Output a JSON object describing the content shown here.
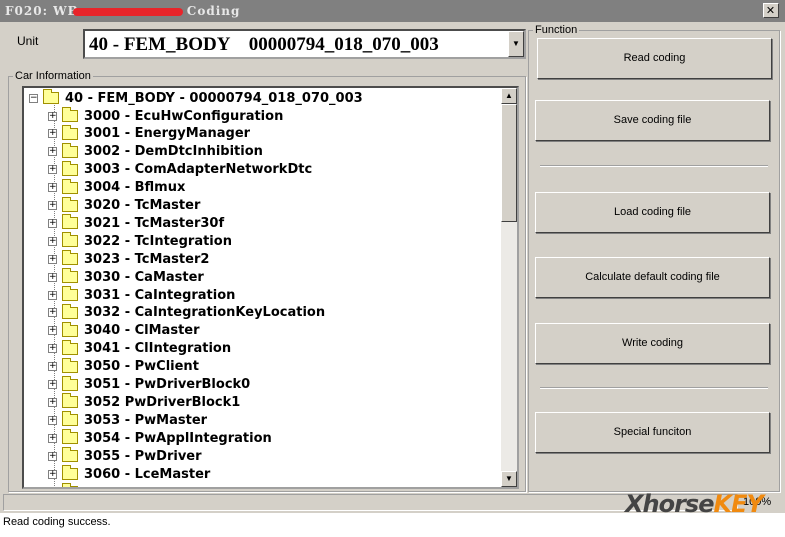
{
  "window": {
    "title_prefix": "F020: WB",
    "title_suffix": "Coding",
    "close": "✕"
  },
  "unit": {
    "label": "Unit",
    "value": "40 - FEM_BODY    00000794_018_070_003"
  },
  "car_info": {
    "legend": "Car Information",
    "root": "40 - FEM_BODY - 00000794_018_070_003",
    "items": [
      "3000 - EcuHwConfiguration",
      "3001 - EnergyManager",
      "3002 - DemDtcInhibition",
      "3003 - ComAdapterNetworkDtc",
      "3004 - Bflmux",
      "3020 - TcMaster",
      "3021 - TcMaster30f",
      "3022 - TcIntegration",
      "3023 - TcMaster2",
      "3030 - CaMaster",
      "3031 - CaIntegration",
      "3032 - CaIntegrationKeyLocation",
      "3040 - ClMaster",
      "3041 - ClIntegration",
      "3050 - PwClient",
      "3051 - PwDriverBlock0",
      "3052   PwDriverBlock1",
      "3053 - PwMaster",
      "3054 - PwApplIntegration",
      "3055 - PwDriver",
      "3060 - LceMaster"
    ]
  },
  "function": {
    "legend": "Function",
    "buttons": [
      "Read coding",
      "Save coding file",
      "Load coding file",
      "Calculate default coding file",
      "Write coding",
      "Special funciton"
    ]
  },
  "progress": {
    "value_percent": 100,
    "label": "100%"
  },
  "status": "Read coding success.",
  "logo": {
    "text1": "Xhorse",
    "text2": "KEY"
  },
  "colors": {
    "folder": "#ffff99",
    "logo_orange": "#f08a10"
  }
}
